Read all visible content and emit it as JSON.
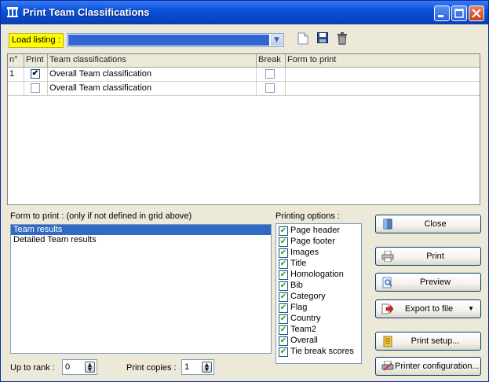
{
  "window": {
    "title": "Print Team Classifications"
  },
  "toolbar": {
    "load_label": "Load listing :",
    "load_value": "",
    "new_icon": "new-document-icon",
    "save_icon": "floppy-disk-icon",
    "delete_icon": "trash-can-icon"
  },
  "grid": {
    "columns": [
      "n°",
      "Print",
      "Team classifications",
      "Break",
      "Form to print"
    ],
    "rows": [
      {
        "n": "1",
        "print": true,
        "name": "Overall Team classification",
        "break": false,
        "form": ""
      },
      {
        "n": "",
        "print": false,
        "name": "Overall Team classification",
        "break": false,
        "form": ""
      }
    ]
  },
  "forms": {
    "label": "Form to print :   (only if not defined in grid above)",
    "items": [
      "Team results",
      "Detailed Team results"
    ],
    "selected_index": 0
  },
  "options": {
    "label": "Printing options :",
    "items": [
      {
        "label": "Page header",
        "checked": true
      },
      {
        "label": "Page footer",
        "checked": true
      },
      {
        "label": "Images",
        "checked": true
      },
      {
        "label": "Title",
        "checked": true
      },
      {
        "label": "Homologation",
        "checked": true
      },
      {
        "label": "Bib",
        "checked": true
      },
      {
        "label": "Category",
        "checked": true
      },
      {
        "label": "Flag",
        "checked": true
      },
      {
        "label": "Country",
        "checked": true
      },
      {
        "label": "Team2",
        "checked": true
      },
      {
        "label": "Overall",
        "checked": true
      },
      {
        "label": "Tie break scores",
        "checked": true
      }
    ]
  },
  "buttons": {
    "close": "Close",
    "print": "Print",
    "preview": "Preview",
    "export": "Export to file",
    "print_setup": "Print setup...",
    "printer_config": "Printer configuration..."
  },
  "bottom": {
    "rank_label": "Up to rank :",
    "rank_value": "0",
    "copies_label": "Print copies :",
    "copies_value": "1"
  },
  "colors": {
    "titlebar": "#0a52dc",
    "selection": "#316ac5",
    "load_label_bg": "#ffff00",
    "window_bg": "#ece9d8"
  }
}
